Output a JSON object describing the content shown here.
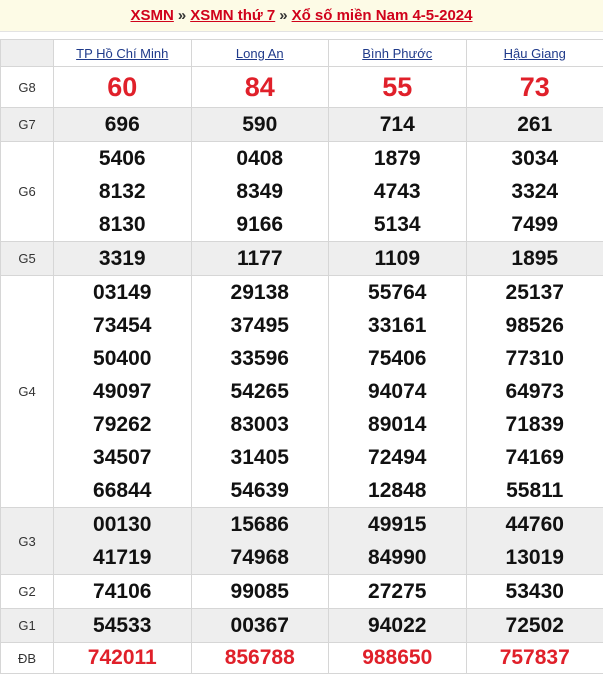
{
  "breadcrumb": {
    "items": [
      "XSMN",
      "XSMN thứ 7",
      "Xổ số miền Nam 4-5-2024"
    ],
    "separator": "»"
  },
  "provinces": [
    "TP Hồ Chí Minh",
    "Long An",
    "Bình Phước",
    "Hậu Giang"
  ],
  "prizes": [
    {
      "label": "G8",
      "values": [
        [
          "60"
        ],
        [
          "84"
        ],
        [
          "55"
        ],
        [
          "73"
        ]
      ]
    },
    {
      "label": "G7",
      "values": [
        [
          "696"
        ],
        [
          "590"
        ],
        [
          "714"
        ],
        [
          "261"
        ]
      ]
    },
    {
      "label": "G6",
      "values": [
        [
          "5406",
          "8132",
          "8130"
        ],
        [
          "0408",
          "8349",
          "9166"
        ],
        [
          "1879",
          "4743",
          "5134"
        ],
        [
          "3034",
          "3324",
          "7499"
        ]
      ]
    },
    {
      "label": "G5",
      "values": [
        [
          "3319"
        ],
        [
          "1177"
        ],
        [
          "1109"
        ],
        [
          "1895"
        ]
      ]
    },
    {
      "label": "G4",
      "values": [
        [
          "03149",
          "73454",
          "50400",
          "49097",
          "79262",
          "34507",
          "66844"
        ],
        [
          "29138",
          "37495",
          "33596",
          "54265",
          "83003",
          "31405",
          "54639"
        ],
        [
          "55764",
          "33161",
          "75406",
          "94074",
          "89014",
          "72494",
          "12848"
        ],
        [
          "25137",
          "98526",
          "77310",
          "64973",
          "71839",
          "74169",
          "55811"
        ]
      ]
    },
    {
      "label": "G3",
      "values": [
        [
          "00130",
          "41719"
        ],
        [
          "15686",
          "74968"
        ],
        [
          "49915",
          "84990"
        ],
        [
          "44760",
          "13019"
        ]
      ]
    },
    {
      "label": "G2",
      "values": [
        [
          "74106"
        ],
        [
          "99085"
        ],
        [
          "27275"
        ],
        [
          "53430"
        ]
      ]
    },
    {
      "label": "G1",
      "values": [
        [
          "54533"
        ],
        [
          "00367"
        ],
        [
          "94022"
        ],
        [
          "72502"
        ]
      ]
    },
    {
      "label": "ĐB",
      "values": [
        [
          "742011"
        ],
        [
          "856788"
        ],
        [
          "988650"
        ],
        [
          "757837"
        ]
      ]
    }
  ],
  "colors": {
    "accent_red": "#e0202a",
    "link_blue": "#1f3a8a",
    "shade": "#eeeeee"
  }
}
